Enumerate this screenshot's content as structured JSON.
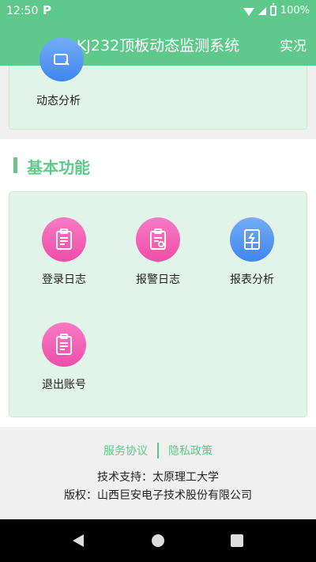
{
  "status": {
    "time": "12:50",
    "notif_icon": "P",
    "battery": "100%"
  },
  "appbar": {
    "title": "KJ232顶板动态监测系统",
    "action": "实况"
  },
  "top_card": {
    "items": [
      {
        "label": "动态分析",
        "icon": "chart-edit-icon",
        "color": "#4a8ff0"
      }
    ]
  },
  "section": {
    "title": "基本功能"
  },
  "functions": [
    {
      "label": "登录日志",
      "icon": "clipboard-download-icon",
      "color": "#f05aaf"
    },
    {
      "label": "报警日志",
      "icon": "clipboard-search-icon",
      "color": "#f05aaf"
    },
    {
      "label": "报表分析",
      "icon": "report-icon",
      "color": "#4a8ff0"
    },
    {
      "label": "退出账号",
      "icon": "clipboard-exit-icon",
      "color": "#f05aaf"
    }
  ],
  "footer": {
    "link1": "服务协议",
    "link2": "隐私政策",
    "support": "技术支持：太原理工大学",
    "copyright": "版权：山西巨安电子技术股份有限公司"
  },
  "colors": {
    "primary": "#5ec98a",
    "card_bg": "#e2f4e9",
    "blue": "#4a8ff0",
    "pink": "#f05aaf"
  }
}
